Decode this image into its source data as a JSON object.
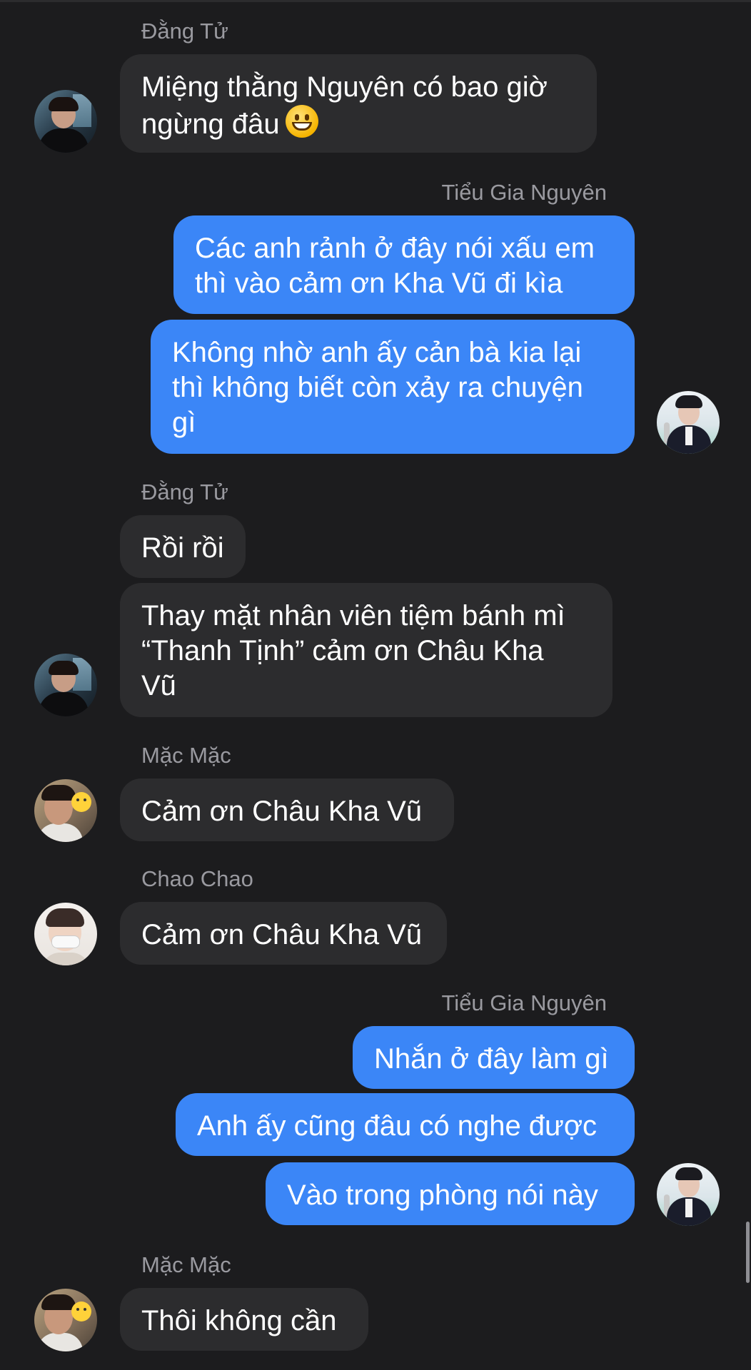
{
  "groups": [
    {
      "sender": "Đằng Tử",
      "side": "in",
      "messages": [
        "Miệng thằng Nguyên có bao giờ\nngừng đâu"
      ],
      "emoji": "grinning-face"
    },
    {
      "sender": "Tiểu Gia Nguyên",
      "side": "out",
      "messages": [
        "Các anh rảnh ở đây nói xấu em\nthì vào cảm ơn Kha Vũ đi kìa",
        "Không nhờ anh ấy cản bà kia lại\nthì không biết còn xảy ra chuyện\ngì"
      ]
    },
    {
      "sender": "Đằng Tử",
      "side": "in",
      "messages": [
        "Rồi rồi",
        "Thay mặt nhân viên tiệm bánh mì\n“Thanh Tịnh” cảm ơn Châu Kha\nVũ"
      ]
    },
    {
      "sender": "Mặc Mặc",
      "side": "in",
      "messages": [
        "Cảm ơn Châu Kha Vũ"
      ]
    },
    {
      "sender": "Chao Chao",
      "side": "in",
      "messages": [
        "Cảm ơn Châu Kha Vũ"
      ]
    },
    {
      "sender": "Tiểu Gia Nguyên",
      "side": "out",
      "messages": [
        "Nhắn ở đây làm gì",
        "Anh ấy cũng đâu có nghe được",
        "Vào trong phòng nói này"
      ]
    },
    {
      "sender": "Mặc Mặc",
      "side": "in",
      "messages": [
        "Thôi không cần"
      ]
    }
  ],
  "colors": {
    "background": "#1c1c1e",
    "incoming_bubble": "#2c2c2e",
    "outgoing_bubble": "#3b86f7",
    "sender_name": "#9a9aa0",
    "message_text": "#ffffff"
  }
}
